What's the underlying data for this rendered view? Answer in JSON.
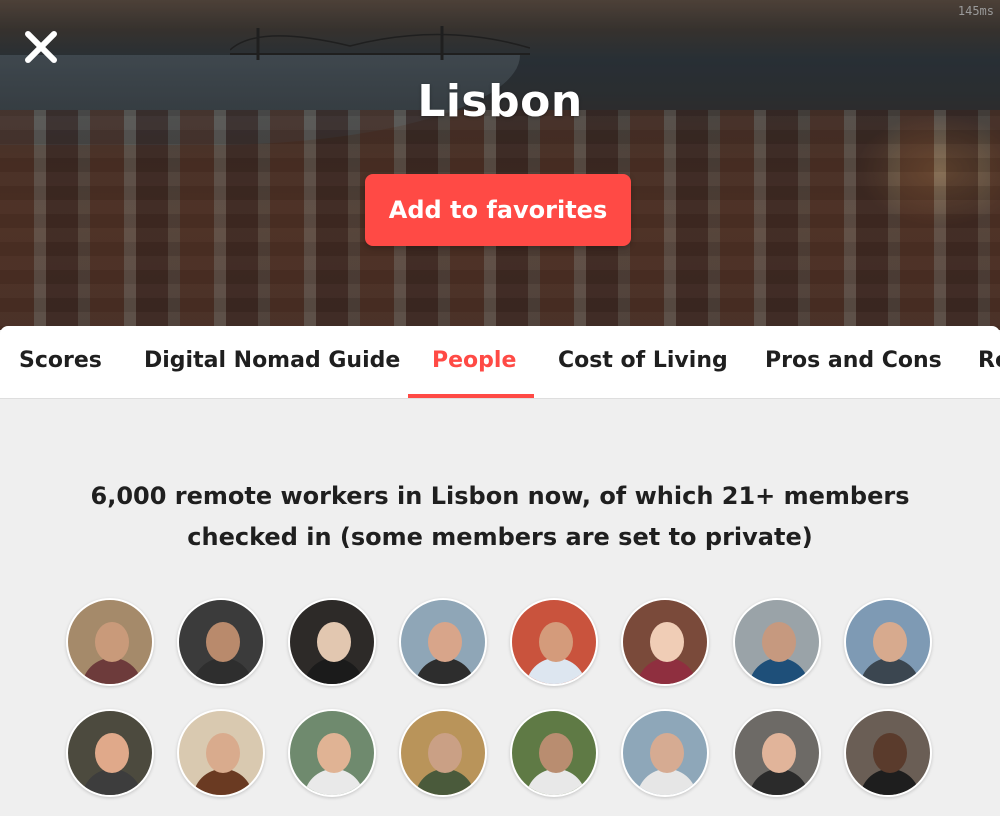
{
  "header": {
    "city": "Lisbon",
    "favorite_label": "Add to favorites",
    "close_icon": "close-icon",
    "timing": "145ms"
  },
  "tabs": [
    {
      "label": "Scores"
    },
    {
      "label": "Digital Nomad Guide"
    },
    {
      "label": "People",
      "active": true
    },
    {
      "label": "Cost of Living"
    },
    {
      "label": "Pros and Cons"
    },
    {
      "label": "Re"
    }
  ],
  "people": {
    "summary_line1": "6,000 remote workers in Lisbon now, of which 21+ members",
    "summary_line2": "checked in (some members are set to private)",
    "avatars": [
      {
        "bg": "#a58a6a",
        "skin": "#c99a7a",
        "shirt": "#6d3b3b"
      },
      {
        "bg": "#3b3b3b",
        "skin": "#b98a6c",
        "shirt": "#2e2e2e"
      },
      {
        "bg": "#2d2a28",
        "skin": "#e2c7b0",
        "shirt": "#1b1b1b"
      },
      {
        "bg": "#8fa6b7",
        "skin": "#d8a58a",
        "shirt": "#2d2d2d"
      },
      {
        "bg": "#c9533d",
        "skin": "#d49b7b",
        "shirt": "#dde6f0"
      },
      {
        "bg": "#7a4a3a",
        "skin": "#f0cdb6",
        "shirt": "#8f2f3f"
      },
      {
        "bg": "#9aa3a8",
        "skin": "#c6997f",
        "shirt": "#1e4f79"
      },
      {
        "bg": "#7e9ab4",
        "skin": "#d7aa8e",
        "shirt": "#3b4650"
      },
      {
        "bg": "#4c4a3e",
        "skin": "#e0a98a",
        "shirt": "#3d3d3d"
      },
      {
        "bg": "#d9c9b0",
        "skin": "#d9ab8d",
        "shirt": "#6a3a22"
      },
      {
        "bg": "#6f8a6e",
        "skin": "#e0b394",
        "shirt": "#e9e9e9"
      },
      {
        "bg": "#b9945a",
        "skin": "#caa085",
        "shirt": "#4a5a3b"
      },
      {
        "bg": "#5f7a45",
        "skin": "#b98d70",
        "shirt": "#e8e8e8"
      },
      {
        "bg": "#8ea7b9",
        "skin": "#d6ab92",
        "shirt": "#e6e6e6"
      },
      {
        "bg": "#6d6a66",
        "skin": "#e1b49a",
        "shirt": "#2b2b2b"
      },
      {
        "bg": "#6a5e55",
        "skin": "#5a3b2c",
        "shirt": "#1e1e1e"
      }
    ]
  },
  "colors": {
    "accent": "#ff4a45",
    "page_bg": "#efefef"
  }
}
